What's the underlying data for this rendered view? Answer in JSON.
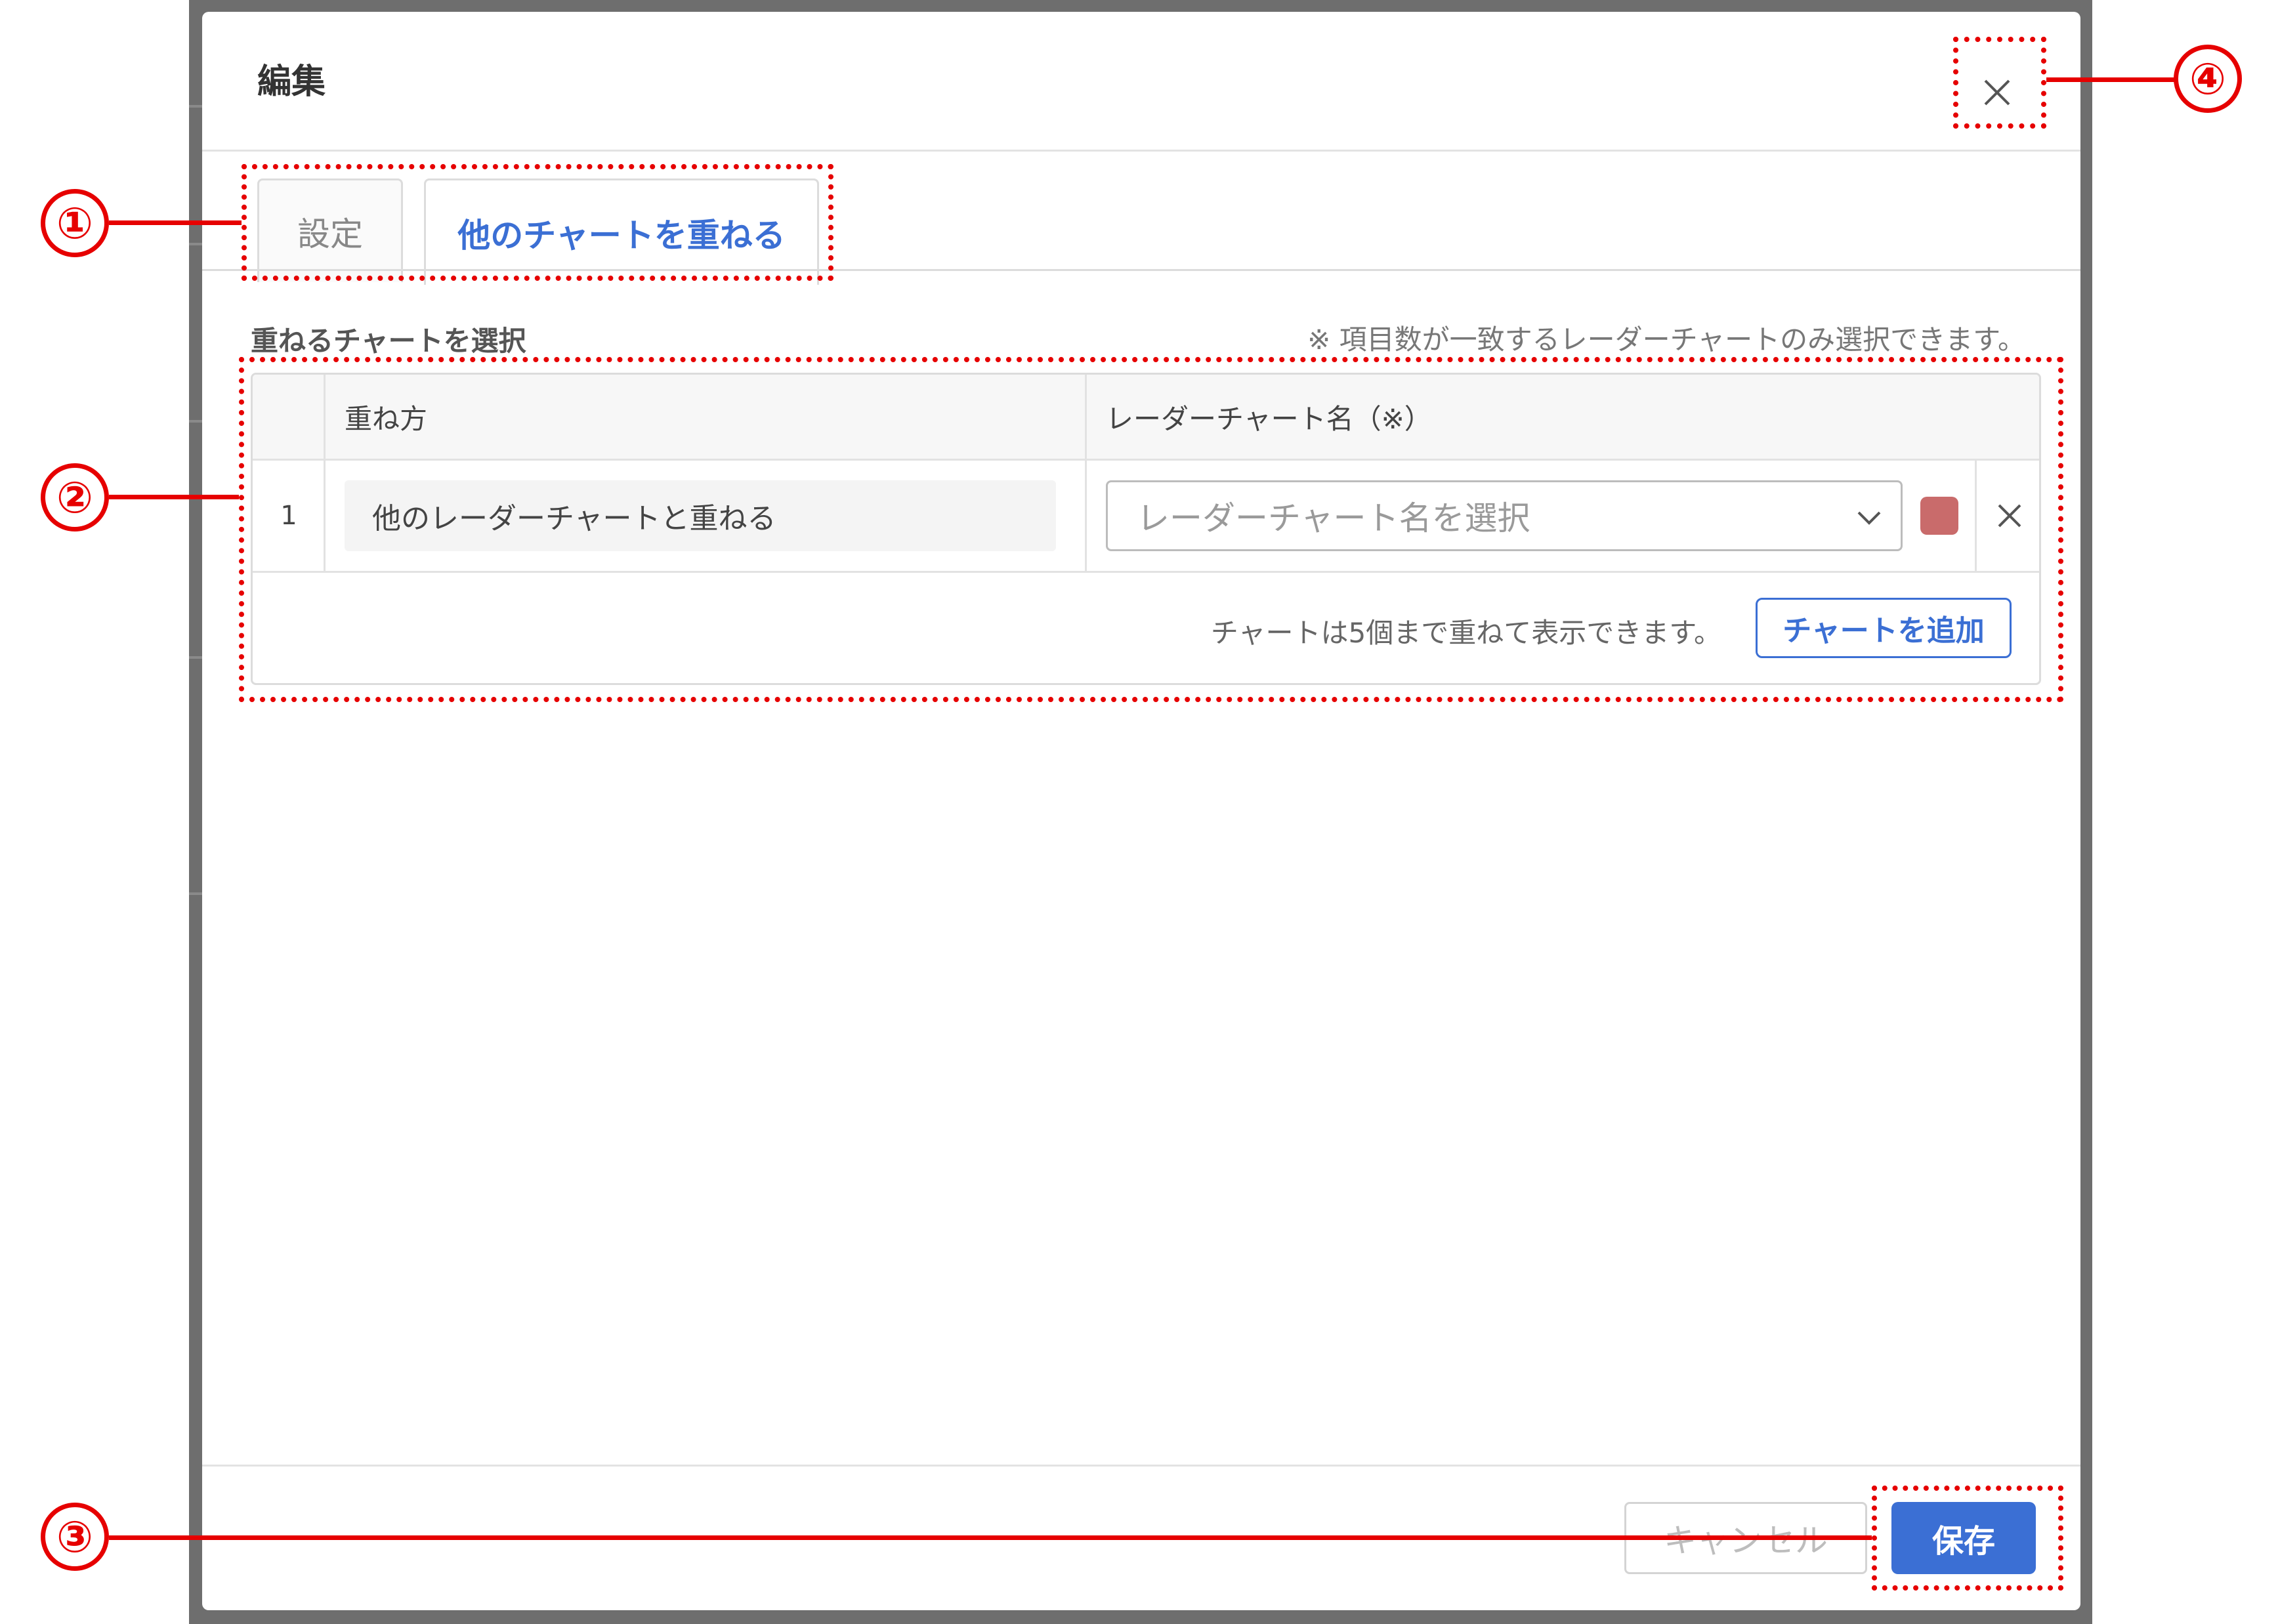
{
  "modal": {
    "title": "編集",
    "tabs": [
      {
        "label": "設定",
        "active": false
      },
      {
        "label": "他のチャートを重ねる",
        "active": true
      }
    ],
    "section": {
      "title": "重ねるチャートを選択",
      "note": "※ 項目数が一致するレーダーチャートのみ選択できます。"
    },
    "table": {
      "headers": [
        "",
        "重ね方",
        "レーダーチャート名（※）"
      ],
      "rows": [
        {
          "index": "1",
          "method": "他のレーダーチャートと重ねる",
          "chart_placeholder": "レーダーチャート名を選択",
          "color": "#c96b6b"
        }
      ],
      "footer_text": "チャートは5個まで重ねて表示できます。",
      "add_button": "チャートを追加"
    },
    "footer": {
      "cancel": "キャンセル",
      "save": "保存"
    }
  },
  "annotations": {
    "callouts": [
      "①",
      "②",
      "③",
      "④"
    ],
    "color": "#e60000"
  },
  "colors": {
    "accent": "#3b6fd4",
    "swatch": "#c96b6b"
  },
  "icons": {
    "close": "close-icon",
    "chevron": "chevron-down-icon",
    "row_delete": "close-icon"
  }
}
